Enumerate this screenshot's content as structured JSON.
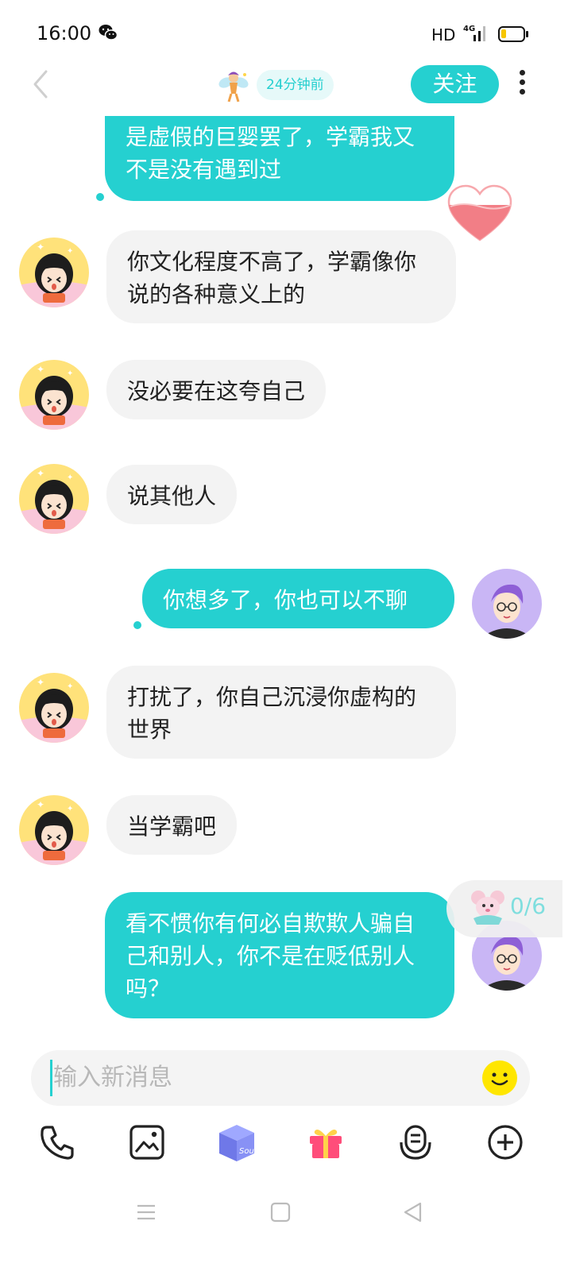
{
  "status_bar": {
    "time": "16:00",
    "network_hd": "HD",
    "network_type": "4G",
    "battery_level": 0.25,
    "battery_fill_color": "#f7c600"
  },
  "header": {
    "last_active": "24分钟前",
    "follow_label": "关注",
    "accent_color": "#25d0d0"
  },
  "messages": [
    {
      "from": "me",
      "text": "是虚假的巨婴罢了，学霸我又不是没有遇到过"
    },
    {
      "from": "peer",
      "text": "你文化程度不高了，学霸像你说的各种意义上的"
    },
    {
      "from": "peer",
      "text": "没必要在这夸自己"
    },
    {
      "from": "peer",
      "text": "说其他人"
    },
    {
      "from": "me",
      "text": "你想多了，你也可以不聊"
    },
    {
      "from": "peer",
      "text": "打扰了，你自己沉浸你虚构的世界"
    },
    {
      "from": "peer",
      "text": "当学霸吧"
    },
    {
      "from": "me",
      "text": "看不惯你有何必自欺欺人骗自己和别人，你不是在贬低别人吗？"
    }
  ],
  "counter": "0/6",
  "input": {
    "placeholder": "输入新消息"
  },
  "toolbar": {
    "items": [
      "phone-icon",
      "image-icon",
      "soul-box-icon",
      "gift-icon",
      "voice-icon",
      "plus-icon"
    ],
    "soul_label": "Soul"
  },
  "nav": {
    "items": [
      "menu-icon",
      "home-icon",
      "back-icon"
    ]
  }
}
